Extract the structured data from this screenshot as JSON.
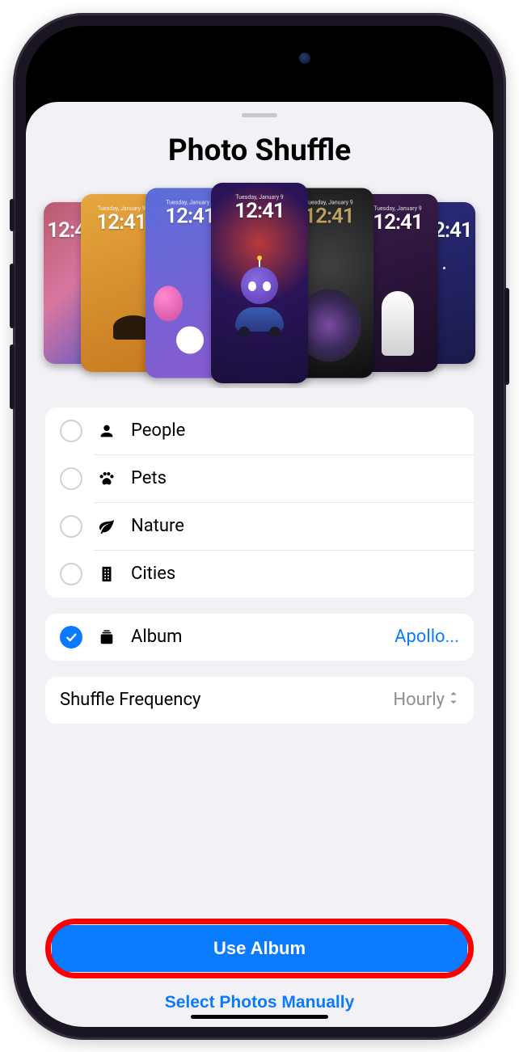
{
  "sheet": {
    "title": "Photo Shuffle"
  },
  "carousel": {
    "date_label": "Tuesday, January 9",
    "time_label": "12:41"
  },
  "options": [
    {
      "label": "People",
      "icon": "person",
      "checked": false
    },
    {
      "label": "Pets",
      "icon": "paw",
      "checked": false
    },
    {
      "label": "Nature",
      "icon": "leaf",
      "checked": false
    },
    {
      "label": "Cities",
      "icon": "building",
      "checked": false
    }
  ],
  "album_row": {
    "label": "Album",
    "value": "Apollo...",
    "checked": true
  },
  "frequency_row": {
    "label": "Shuffle Frequency",
    "value": "Hourly"
  },
  "primary_button": "Use Album",
  "secondary_button": "Select Photos Manually"
}
